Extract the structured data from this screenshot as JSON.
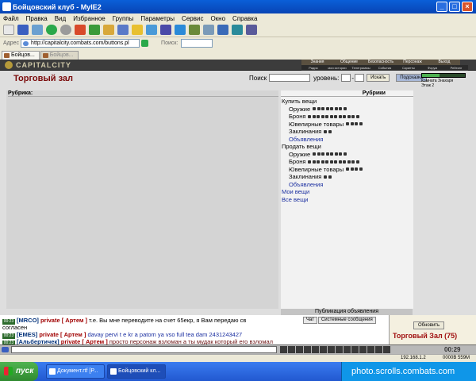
{
  "window": {
    "title": "Бойцовский клуб - MyIE2"
  },
  "menu": [
    "Файл",
    "Правка",
    "Вид",
    "Избранное",
    "Группы",
    "Параметры",
    "Сервис",
    "Окно",
    "Справка"
  ],
  "address": {
    "label": "Адрес",
    "url": "http://capitalcity.combats.com/buttons.pl",
    "search_label": "Поиск:"
  },
  "tabs": [
    "Бойцов...",
    "Бойцов..."
  ],
  "game": {
    "logo": "CAPITALCITY",
    "nav": [
      "Знания",
      "Общение",
      "Безопасность",
      "Персонаж",
      "Выход"
    ],
    "subnav": [
      "Радио",
      "мои истории",
      "Телеграммы",
      "События",
      "Скрипты",
      "Форум",
      "Рейтинг"
    ]
  },
  "page": {
    "title": "Торговый зал",
    "search_label": "Поиск",
    "level_label": "уровень:",
    "level_sep": "-",
    "search_button": "Искать",
    "hint_button": "Подсказка",
    "room_line1": "Комната Знахаря",
    "room_line2": "Этаж 2"
  },
  "left_panel": {
    "header": "Рубрика:"
  },
  "right_panel": {
    "header": "Рубрики",
    "buy": "Купить вещи",
    "sell": "Продать вещи",
    "weapons": "Оружие",
    "armor": "Броня",
    "jewelry": "Ювелирные товары",
    "spells": "Заклинания",
    "ads": "Объявления",
    "my_items": "Мои вещи",
    "all_items": "Все вещи"
  },
  "publish_bar": "Публикация объявления",
  "chat_tabs": [
    "Чат",
    "Системные сообщения"
  ],
  "chat": [
    {
      "nick": "[MRCO]",
      "priv": "private [ Артем ]",
      "text": "т.е. Вы мне переводите на счет 65екр, я Вам передаю св",
      "cls": ""
    },
    {
      "nick": "",
      "priv": "",
      "text": "согласен",
      "cls": ""
    },
    {
      "nick": "[EMES]",
      "priv": "private [ Артем ]",
      "text": "davay pervi t e kr a patom ya vso full tea dam 2431243427",
      "cls": "blue"
    },
    {
      "nick": "[Альбертичек]",
      "priv": "private [ Артем ]",
      "text": "просто персонаж взломан а ты мудак который его взломал",
      "cls": "dark"
    }
  ],
  "side": {
    "update_button": "Обновить",
    "location": "Торговый Зал (75)"
  },
  "clock": "00:29",
  "status": {
    "ip": "192.168.1.2",
    "bytes": "0000B",
    "mem": "559M"
  },
  "taskbar": {
    "start": "пуск",
    "tasks": [
      "Документ.rtf [Р...",
      "Бойцовский кл..."
    ],
    "tray_text": "photo.scrolls.combats.com"
  },
  "colors": {
    "title_red": "#7a0a0a",
    "link_blue": "#1a2ea0",
    "xp_blue": "#0a5fd8"
  }
}
